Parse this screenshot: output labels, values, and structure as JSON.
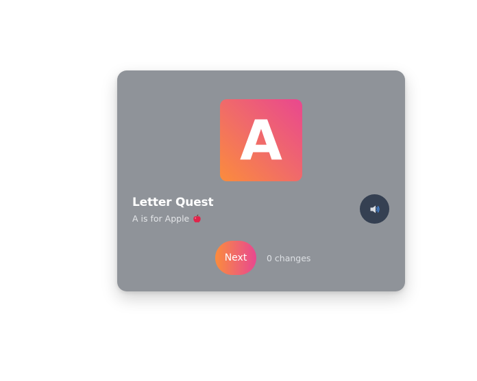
{
  "card": {
    "letter": "A",
    "title": "Letter Quest",
    "subtitle": "A is for Apple",
    "subtitle_icon": "apple-icon",
    "sound_icon": "speaker-icon",
    "next_label": "Next",
    "changes_text": "0 changes"
  },
  "colors": {
    "card_background": "#8f9399",
    "gradient_start": "#fb8c3c",
    "gradient_end": "#e9478f",
    "sound_button": "#354052"
  }
}
